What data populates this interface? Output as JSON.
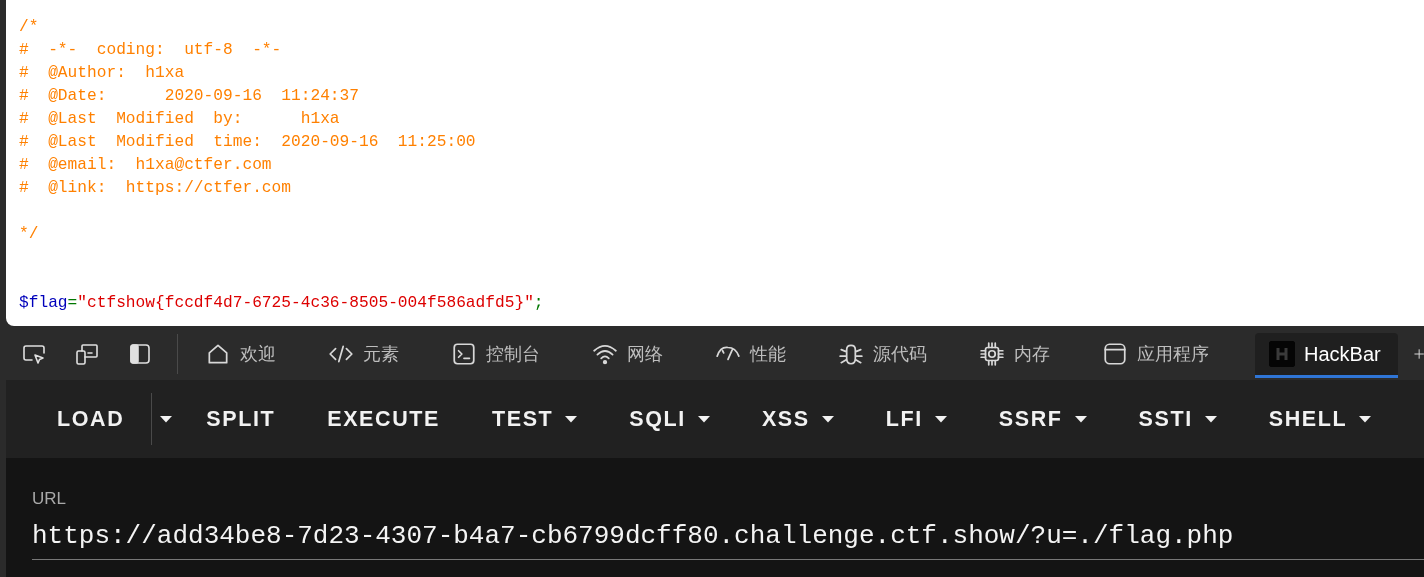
{
  "page": {
    "comment": "/*\n#  -*-  coding:  utf-8  -*-\n#  @Author:  h1xa\n#  @Date:      2020-09-16  11:24:37\n#  @Last  Modified  by:      h1xa\n#  @Last  Modified  time:  2020-09-16  11:25:00\n#  @email:  h1xa@ctfer.com\n#  @link:  https://ctfer.com\n\n*/",
    "code_tokens": [
      {
        "kind": "variable",
        "text": "$flag"
      },
      {
        "kind": "operator",
        "text": "="
      },
      {
        "kind": "string",
        "text": "\"ctfshow{fccdf4d7-6725-4c36-8505-004f586adfd5}\""
      },
      {
        "kind": "operator",
        "text": ";"
      }
    ]
  },
  "devtools_tabs": [
    {
      "label": "欢迎",
      "kind": "home",
      "selected": false
    },
    {
      "label": "元素",
      "kind": "code",
      "selected": false
    },
    {
      "label": "控制台",
      "kind": "terminal",
      "selected": false
    },
    {
      "label": "网络",
      "kind": "wifi",
      "selected": false
    },
    {
      "label": "性能",
      "kind": "gauge",
      "selected": false
    },
    {
      "label": "源代码",
      "kind": "bug",
      "selected": false
    },
    {
      "label": "内存",
      "kind": "chip",
      "selected": false
    },
    {
      "label": "应用程序",
      "kind": "window",
      "selected": false
    },
    {
      "label": "HackBar",
      "kind": "hackbar",
      "selected": true
    }
  ],
  "hackbar": {
    "menu": [
      {
        "label": "LOAD",
        "kind": "split"
      },
      {
        "label": "SPLIT",
        "kind": "button"
      },
      {
        "label": "EXECUTE",
        "kind": "button"
      },
      {
        "label": "TEST",
        "kind": "menu"
      },
      {
        "label": "SQLI",
        "kind": "menu"
      },
      {
        "label": "XSS",
        "kind": "menu"
      },
      {
        "label": "LFI",
        "kind": "menu"
      },
      {
        "label": "SSRF",
        "kind": "menu"
      },
      {
        "label": "SSTI",
        "kind": "menu"
      },
      {
        "label": "SHELL",
        "kind": "menu"
      }
    ],
    "url_field": {
      "label": "URL",
      "value": "https://add34be8-7d23-4307-b4a7-cb6799dcff80.challenge.ctf.show/?u=./flag.php"
    }
  }
}
